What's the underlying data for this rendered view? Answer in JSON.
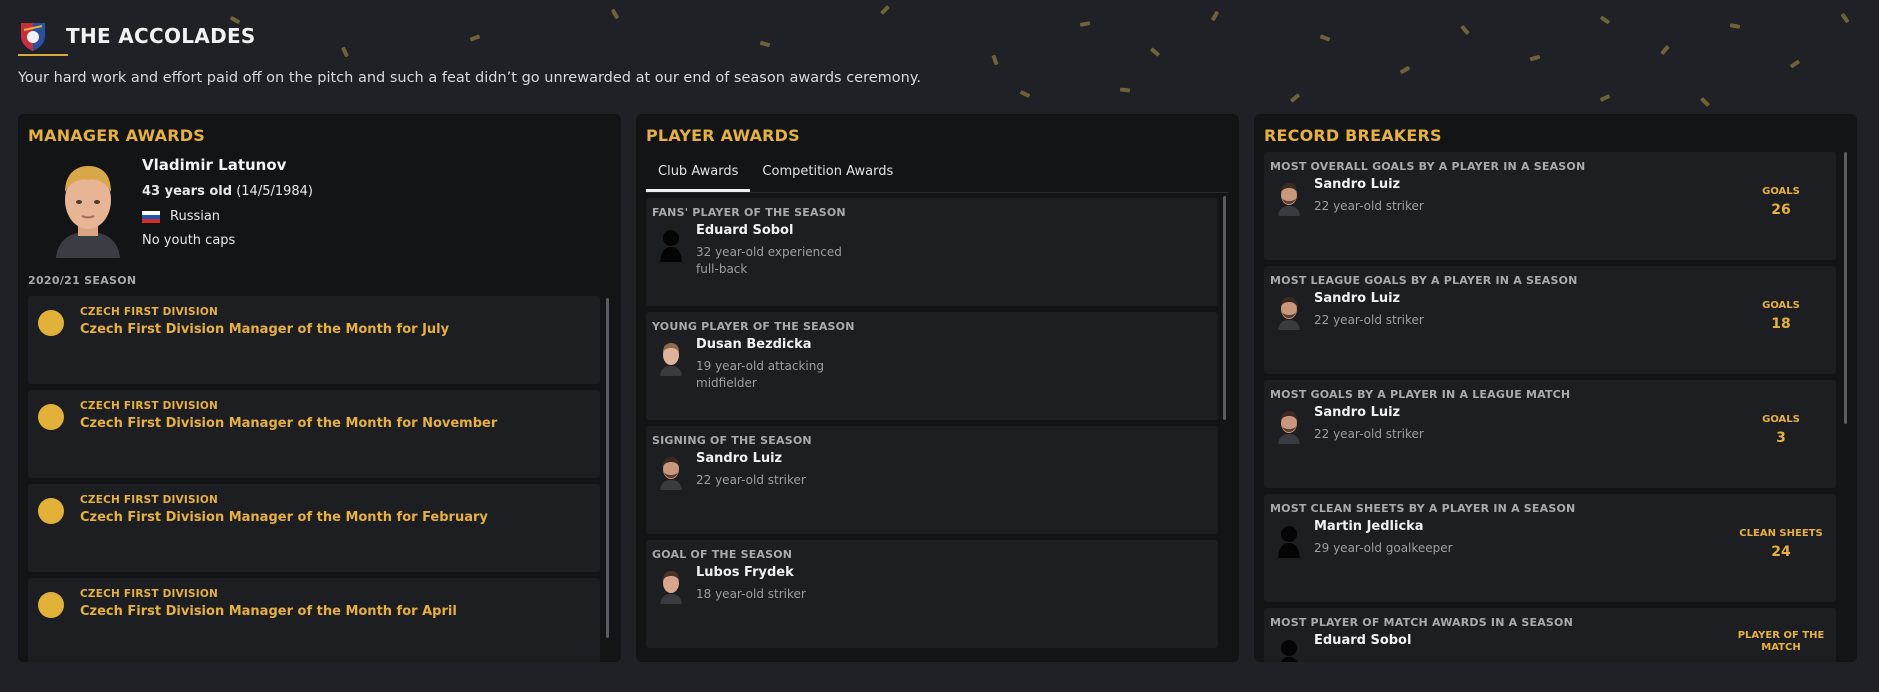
{
  "header": {
    "title": "THE ACCOLADES",
    "subtitle": "Your hard work and effort paid off on the pitch and such a feat didn’t go unrewarded at our end of season awards ceremony.",
    "club_logo": "club-crest-icon"
  },
  "colors": {
    "accent": "#e6b13c",
    "background": "#1f2126",
    "panel": "#131416",
    "card": "#1d1e22"
  },
  "manager": {
    "panel_title": "MANAGER AWARDS",
    "name": "Vladimir Latunov",
    "age": "43 years old",
    "dob": "(14/5/1984)",
    "nationality": "Russian",
    "caps": "No youth caps",
    "season": "2020/21 SEASON",
    "awards": [
      {
        "competition": "CZECH FIRST DIVISION",
        "title": "Czech First Division Manager of the Month for July",
        "icon": "medal-icon"
      },
      {
        "competition": "CZECH FIRST DIVISION",
        "title": "Czech First Division Manager of the Month for November",
        "icon": "medal-icon"
      },
      {
        "competition": "CZECH FIRST DIVISION",
        "title": "Czech First Division Manager of the Month for February",
        "icon": "medal-icon"
      },
      {
        "competition": "CZECH FIRST DIVISION",
        "title": "Czech First Division Manager of the Month for April",
        "icon": "medal-icon"
      }
    ]
  },
  "players": {
    "panel_title": "PLAYER AWARDS",
    "tabs": [
      {
        "label": "Club Awards",
        "active": true
      },
      {
        "label": "Competition Awards",
        "active": false
      }
    ],
    "awards": [
      {
        "category": "FANS' PLAYER OF THE SEASON",
        "name": "Eduard Sobol",
        "desc": "32 year-old experienced full-back",
        "face": "silhouette"
      },
      {
        "category": "YOUNG PLAYER OF THE SEASON",
        "name": "Dusan Bezdicka",
        "desc": "19 year-old attacking midfielder",
        "face": "photo"
      },
      {
        "category": "SIGNING OF THE SEASON",
        "name": "Sandro Luiz",
        "desc": "22 year-old striker",
        "face": "photo"
      },
      {
        "category": "GOAL OF THE SEASON",
        "name": "Lubos Frydek",
        "desc": "18 year-old striker",
        "face": "photo"
      }
    ]
  },
  "records": {
    "panel_title": "RECORD BREAKERS",
    "items": [
      {
        "category": "MOST OVERALL GOALS BY A PLAYER IN A SEASON",
        "name": "Sandro Luiz",
        "desc": "22 year-old striker",
        "stat_label": "GOALS",
        "stat_value": "26",
        "face": "photo"
      },
      {
        "category": "MOST LEAGUE GOALS BY A PLAYER IN A SEASON",
        "name": "Sandro Luiz",
        "desc": "22 year-old striker",
        "stat_label": "GOALS",
        "stat_value": "18",
        "face": "photo"
      },
      {
        "category": "MOST GOALS BY A PLAYER IN A LEAGUE MATCH",
        "name": "Sandro Luiz",
        "desc": "22 year-old striker",
        "stat_label": "GOALS",
        "stat_value": "3",
        "face": "photo"
      },
      {
        "category": "MOST CLEAN SHEETS BY A PLAYER IN A SEASON",
        "name": "Martin Jedlicka",
        "desc": "29 year-old goalkeeper",
        "stat_label": "CLEAN SHEETS",
        "stat_value": "24",
        "face": "silhouette"
      },
      {
        "category": "MOST PLAYER OF MATCH AWARDS IN A SEASON",
        "name": "Eduard Sobol",
        "desc": "",
        "stat_label": "PLAYER OF THE MATCH",
        "stat_value": "",
        "face": "silhouette"
      }
    ]
  }
}
